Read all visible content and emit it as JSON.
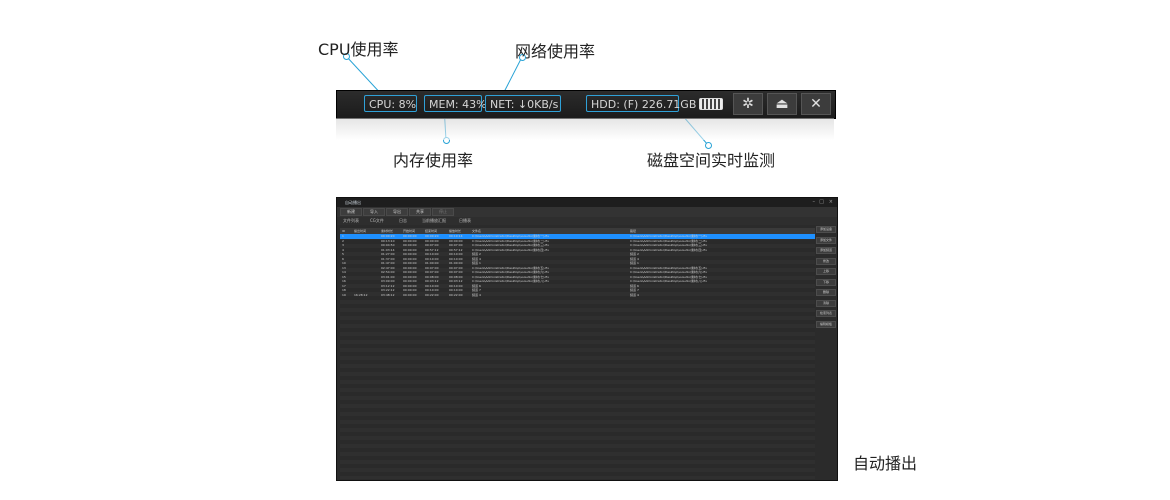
{
  "annotations": {
    "cpu": "CPU使用率",
    "net": "网络使用率",
    "mem": "内存使用率",
    "hdd": "磁盘空间实时监测",
    "auto": "自动播出"
  },
  "statusbar": {
    "cpu": "CPU: 8%",
    "mem": "MEM: 43%",
    "net": "NET: ↓0KB/s",
    "hdd": "HDD: (F) 226.71GB",
    "settings_icon": "gear-icon",
    "eject_icon": "eject-icon",
    "close_icon": "close-icon",
    "keyboard_icon": "keyboard-icon"
  },
  "window": {
    "title": "自动播出",
    "toolbar": [
      "新建",
      "导入",
      "导出",
      "共享",
      "停止"
    ],
    "tabs": [
      "文件列表",
      "CG文件",
      "日志",
      "当前播放汇报",
      "日播表"
    ],
    "columns": [
      "ID",
      "播出时间",
      "素材时长",
      "开始时间",
      "结束时间",
      "播放时长",
      "文件名",
      "路径"
    ],
    "rows": [
      [
        "1",
        "",
        "00:00:20",
        "00:00:00",
        "00:00:20",
        "00:10:14",
        "C:\\Users\\Administrator\\Desktop\\vsoudio\\素材(一).flv",
        "C:\\Users\\Administrator\\Desktop\\vsoudio\\素材(一).flv"
      ],
      [
        "2",
        "",
        "00:13:10",
        "00:00:00",
        "00:00:00",
        "00:00:00",
        "C:\\Users\\Administrator\\Desktop\\vsoudio\\素材(二).flv",
        "C:\\Users\\Administrator\\Desktop\\vsoudio\\素材(二).flv"
      ],
      [
        "3",
        "",
        "00:04:50",
        "00:00:00",
        "00:07:00",
        "00:07:00",
        "C:\\Users\\Administrator\\Desktop\\vsoudio\\素材(三).flv",
        "C:\\Users\\Administrator\\Desktop\\vsoudio\\素材(三).flv"
      ],
      [
        "4",
        "",
        "01:03:14",
        "00:00:00",
        "00:57:12",
        "00:57:12",
        "C:\\Users\\Administrator\\Desktop\\vsoudio\\素材(四).flv",
        "C:\\Users\\Administrator\\Desktop\\vsoudio\\素材(四).flv"
      ],
      [
        "5",
        "",
        "01:27:00",
        "00:00:00",
        "00:10:00",
        "00:10:00",
        "频道 2",
        "频道 2"
      ],
      [
        "6",
        "",
        "01:37:00",
        "00:00:00",
        "00:10:00",
        "00:10:00",
        "频道 4",
        "频道 4"
      ],
      [
        "10",
        "",
        "01:47:00",
        "00:00:00",
        "01:00:00",
        "01:00:00",
        "频道 1",
        "频道 1"
      ],
      [
        "13",
        "",
        "02:47:00",
        "00:00:00",
        "00:07:00",
        "00:07:00",
        "C:\\Users\\Administrator\\Desktop\\vsoudio\\素材(五).flv",
        "C:\\Users\\Administrator\\Desktop\\vsoudio\\素材(五).flv"
      ],
      [
        "14",
        "",
        "02:54:00",
        "00:00:00",
        "00:07:00",
        "00:07:00",
        "C:\\Users\\Administrator\\Desktop\\vsoudio\\素材(六).flv",
        "C:\\Users\\Administrator\\Desktop\\vsoudio\\素材(六).flv"
      ],
      [
        "15",
        "",
        "03:01:00",
        "00:00:00",
        "00:08:00",
        "00:08:00",
        "C:\\Users\\Administrator\\Desktop\\vsoudio\\素材(七).flv",
        "C:\\Users\\Administrator\\Desktop\\vsoudio\\素材(七).flv"
      ],
      [
        "16",
        "",
        "03:09:00",
        "00:00:00",
        "00:03:12",
        "00:03:12",
        "C:\\Users\\Administrator\\Desktop\\vsoudio\\素材(八).flv",
        "C:\\Users\\Administrator\\Desktop\\vsoudio\\素材(八).flv"
      ],
      [
        "17",
        "",
        "03:12:12",
        "00:00:00",
        "00:10:00",
        "00:10:00",
        "频道 6",
        "频道 6"
      ],
      [
        "18",
        "",
        "03:22:12",
        "00:00:00",
        "00:10:00",
        "00:10:00",
        "频道 7",
        "频道 7"
      ],
      [
        "19",
        "16:28:12",
        "03:48:12",
        "00:00:00",
        "00:22:00",
        "00:22:00",
        "频道 4",
        "频道 4"
      ]
    ],
    "side_buttons": [
      "添加设备",
      "添加文件",
      "添加频道",
      "修改",
      "上移",
      "下移",
      "删除",
      "清除",
      "检索列表",
      "编辑模板"
    ]
  }
}
